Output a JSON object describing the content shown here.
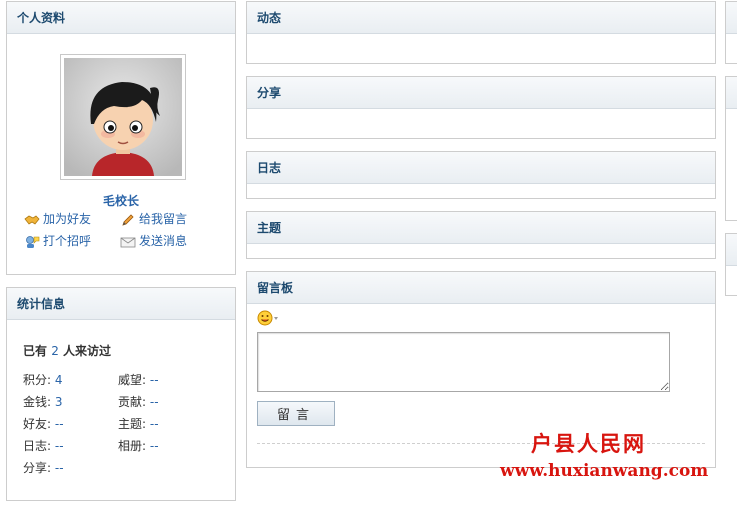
{
  "profile": {
    "title": "个人资料",
    "user_name": "毛校长",
    "actions": {
      "add_friend": "加为好友",
      "leave_message": "给我留言",
      "greet": "打个招呼",
      "send_message": "发送消息"
    }
  },
  "stats": {
    "title": "统计信息",
    "visit_prefix": "已有",
    "visit_count": "2",
    "visit_suffix": "人来访过",
    "items": [
      {
        "label": "积分:",
        "value": "4"
      },
      {
        "label": "威望:",
        "value": "--"
      },
      {
        "label": "金钱:",
        "value": "3"
      },
      {
        "label": "贡献:",
        "value": "--"
      },
      {
        "label": "好友:",
        "value": "--"
      },
      {
        "label": "主题:",
        "value": "--"
      },
      {
        "label": "日志:",
        "value": "--"
      },
      {
        "label": "相册:",
        "value": "--"
      },
      {
        "label": "分享:",
        "value": "--"
      }
    ]
  },
  "sections": {
    "feed": "动态",
    "share": "分享",
    "blog": "日志",
    "topic": "主题",
    "wall": "留言板"
  },
  "wall": {
    "submit_label": "留言",
    "input_value": ""
  },
  "watermark": {
    "site_name": "户县人民网",
    "url": "www.huxianwang.com"
  },
  "icons": {
    "add_friend": "handshake-icon",
    "leave_message": "pencil-icon",
    "greet": "greet-icon",
    "send_message": "envelope-icon",
    "smiley": "smiley-icon"
  },
  "colors": {
    "link": "#2a64a8",
    "heading": "#1d4a6f",
    "watermark": "#d8150f"
  }
}
